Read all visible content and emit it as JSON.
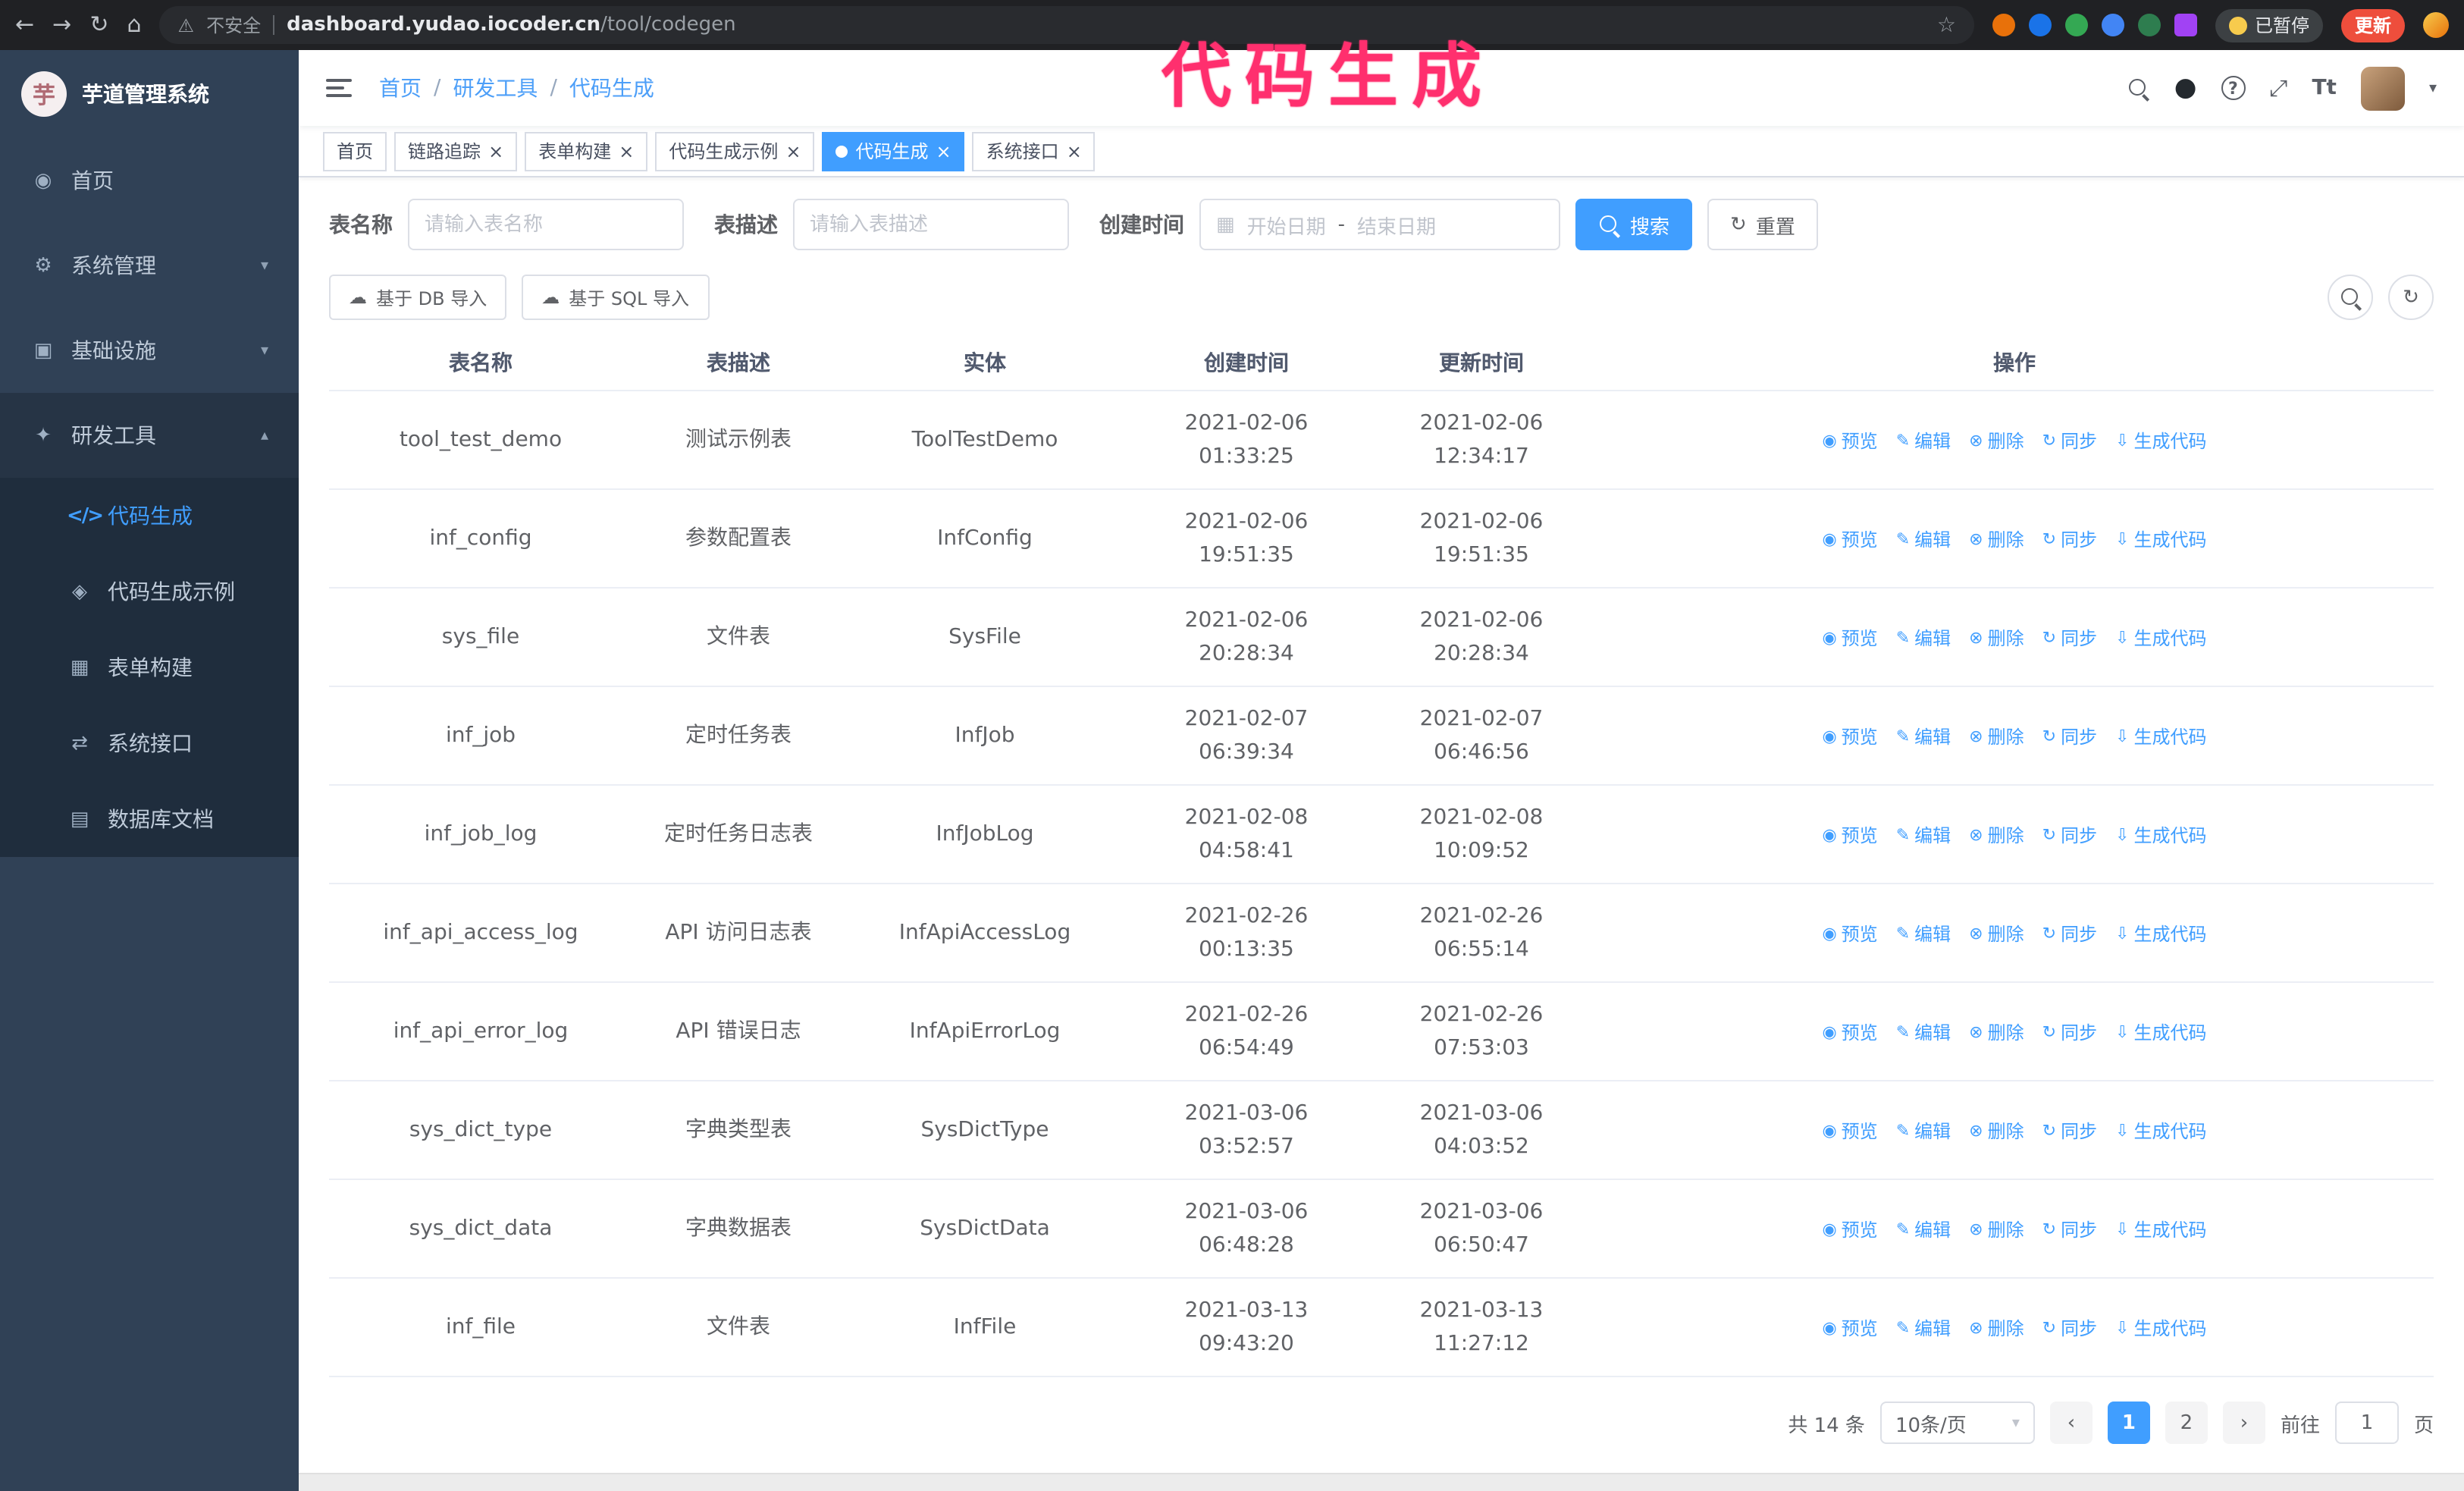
{
  "colors": {
    "accent": "#409eff",
    "sidebar_bg": "#304156",
    "submenu_bg": "#1f2d3d",
    "annotation_pink": "#ff2f6e",
    "update_button_red": "#ee4e3c"
  },
  "browser": {
    "security_warning": "不安全",
    "url_host": "dashboard.yudao.iocoder.cn",
    "url_path": "/tool/codegen",
    "paused_badge": "已暂停",
    "update_button": "更新"
  },
  "annotation": {
    "text": "代码生成"
  },
  "sidebar": {
    "logo_char": "芋",
    "title": "芋道管理系统",
    "items": [
      {
        "label": "首页"
      },
      {
        "label": "系统管理"
      },
      {
        "label": "基础设施"
      },
      {
        "label": "研发工具",
        "children": [
          {
            "label": "代码生成"
          },
          {
            "label": "代码生成示例"
          },
          {
            "label": "表单构建"
          },
          {
            "label": "系统接口"
          },
          {
            "label": "数据库文档"
          }
        ]
      }
    ]
  },
  "header": {
    "breadcrumb": [
      "首页",
      "研发工具",
      "代码生成"
    ],
    "separator": "/"
  },
  "tabs": [
    {
      "label": "首页",
      "closable": false,
      "active": false
    },
    {
      "label": "链路追踪",
      "closable": true,
      "active": false
    },
    {
      "label": "表单构建",
      "closable": true,
      "active": false
    },
    {
      "label": "代码生成示例",
      "closable": true,
      "active": false
    },
    {
      "label": "代码生成",
      "closable": true,
      "active": true
    },
    {
      "label": "系统接口",
      "closable": true,
      "active": false
    }
  ],
  "filters": {
    "table_name_label": "表名称",
    "table_name_placeholder": "请输入表名称",
    "table_desc_label": "表描述",
    "table_desc_placeholder": "请输入表描述",
    "create_time_label": "创建时间",
    "date_start_placeholder": "开始日期",
    "date_separator": "-",
    "date_end_placeholder": "结束日期",
    "search_button": "搜索",
    "reset_button": "重置"
  },
  "toolbar": {
    "import_db": "基于 DB 导入",
    "import_sql": "基于 SQL 导入"
  },
  "table": {
    "columns": [
      "表名称",
      "表描述",
      "实体",
      "创建时间",
      "更新时间",
      "操作"
    ],
    "actions": [
      "预览",
      "编辑",
      "删除",
      "同步",
      "生成代码"
    ],
    "rows": [
      {
        "name": "tool_test_demo",
        "desc": "测试示例表",
        "entity": "ToolTestDemo",
        "created": "2021-02-06 01:33:25",
        "updated": "2021-02-06 12:34:17"
      },
      {
        "name": "inf_config",
        "desc": "参数配置表",
        "entity": "InfConfig",
        "created": "2021-02-06 19:51:35",
        "updated": "2021-02-06 19:51:35"
      },
      {
        "name": "sys_file",
        "desc": "文件表",
        "entity": "SysFile",
        "created": "2021-02-06 20:28:34",
        "updated": "2021-02-06 20:28:34"
      },
      {
        "name": "inf_job",
        "desc": "定时任务表",
        "entity": "InfJob",
        "created": "2021-02-07 06:39:34",
        "updated": "2021-02-07 06:46:56"
      },
      {
        "name": "inf_job_log",
        "desc": "定时任务日志表",
        "entity": "InfJobLog",
        "created": "2021-02-08 04:58:41",
        "updated": "2021-02-08 10:09:52"
      },
      {
        "name": "inf_api_access_log",
        "desc": "API 访问日志表",
        "entity": "InfApiAccessLog",
        "created": "2021-02-26 00:13:35",
        "updated": "2021-02-26 06:55:14"
      },
      {
        "name": "inf_api_error_log",
        "desc": "API 错误日志",
        "entity": "InfApiErrorLog",
        "created": "2021-02-26 06:54:49",
        "updated": "2021-02-26 07:53:03"
      },
      {
        "name": "sys_dict_type",
        "desc": "字典类型表",
        "entity": "SysDictType",
        "created": "2021-03-06 03:52:57",
        "updated": "2021-03-06 04:03:52"
      },
      {
        "name": "sys_dict_data",
        "desc": "字典数据表",
        "entity": "SysDictData",
        "created": "2021-03-06 06:48:28",
        "updated": "2021-03-06 06:50:47"
      },
      {
        "name": "inf_file",
        "desc": "文件表",
        "entity": "InfFile",
        "created": "2021-03-13 09:43:20",
        "updated": "2021-03-13 11:27:12"
      }
    ]
  },
  "pagination": {
    "total": "共 14 条",
    "page_size": "10条/页",
    "pages": [
      "1",
      "2"
    ],
    "active_page": "1",
    "goto_prefix": "前往",
    "goto_value": "1",
    "goto_suffix": "页"
  },
  "icons": {
    "back": "←",
    "forward": "→",
    "reload": "↻",
    "home": "⌂",
    "warning": "⚠",
    "star": "☆",
    "close": "×",
    "chevron_down": "▾",
    "chevron_up": "▴",
    "caret_down": "▾",
    "dashboard": "◉",
    "gear": "⚙",
    "infrastructure": "▣",
    "tools": "✦",
    "code": "</>",
    "example": "◈",
    "form_builder": "▦",
    "api": "⇄",
    "db_doc": "▤",
    "github": "●",
    "question": "?",
    "fullscreen": "⤢",
    "fontsize": "Tt",
    "calendar": "▦",
    "cloud_upload": "☁",
    "refresh": "↻",
    "eye": "◉",
    "edit": "✎",
    "trash": "⊗",
    "sync": "↻",
    "download": "⇩",
    "prev": "‹",
    "next": "›"
  }
}
